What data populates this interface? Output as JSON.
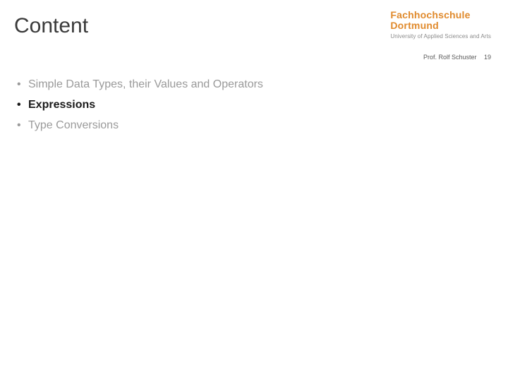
{
  "title": "Content",
  "logo": {
    "line1": "Fachhochschule",
    "line2": "Dortmund",
    "subtitle": "University of Applied Sciences and Arts"
  },
  "meta": {
    "author": "Prof. Rolf Schuster",
    "page": "19"
  },
  "items": [
    {
      "label": "Simple Data Types, their Values and Operators",
      "active": false
    },
    {
      "label": "Expressions",
      "active": true
    },
    {
      "label": "Type Conversions",
      "active": false
    }
  ]
}
